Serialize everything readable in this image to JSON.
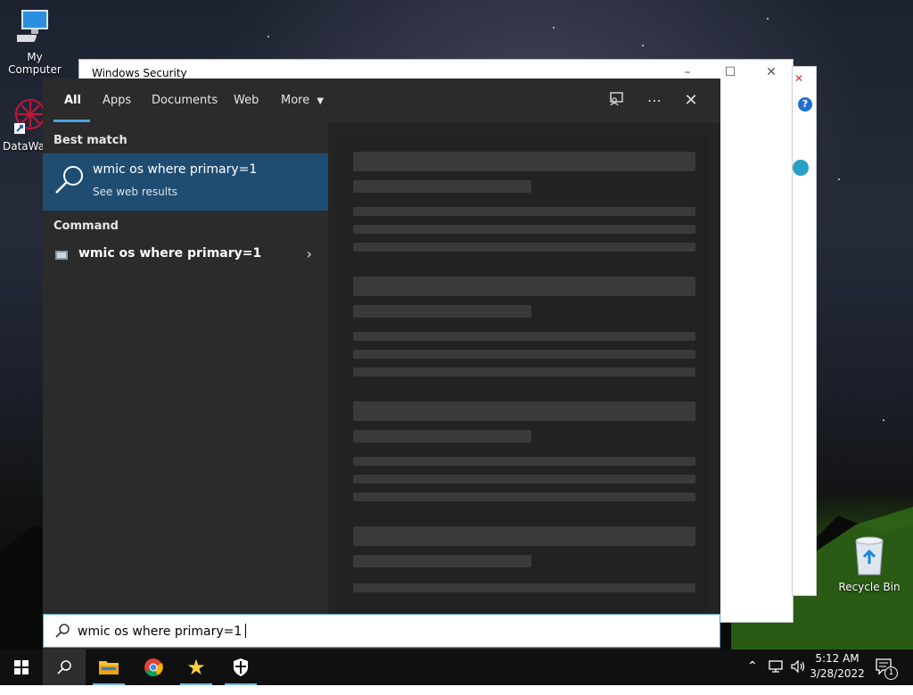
{
  "desktop": {
    "icons": [
      {
        "label": "My Computer"
      },
      {
        "label": "DataWag"
      },
      {
        "label": "Recycle Bin"
      }
    ]
  },
  "security_window": {
    "title": "Windows Security"
  },
  "search_panel": {
    "tabs": [
      {
        "label": "All",
        "active": true
      },
      {
        "label": "Apps"
      },
      {
        "label": "Documents"
      },
      {
        "label": "Web"
      },
      {
        "label": "More"
      }
    ],
    "best_match_heading": "Best match",
    "best_match": {
      "title": "wmic os where primary=1",
      "subtitle": "See web results"
    },
    "command_heading": "Command",
    "command_item": {
      "title": "wmic os where primary=1"
    },
    "search_box": {
      "value": "wmic os where primary=1"
    }
  },
  "taskbar": {
    "clock_time": "5:12 AM",
    "clock_date": "3/28/2022",
    "notification_count": "1"
  },
  "colors": {
    "accent": "#4ca3dd",
    "highlight": "#1f4d72",
    "panel": "#2b2b2b"
  }
}
